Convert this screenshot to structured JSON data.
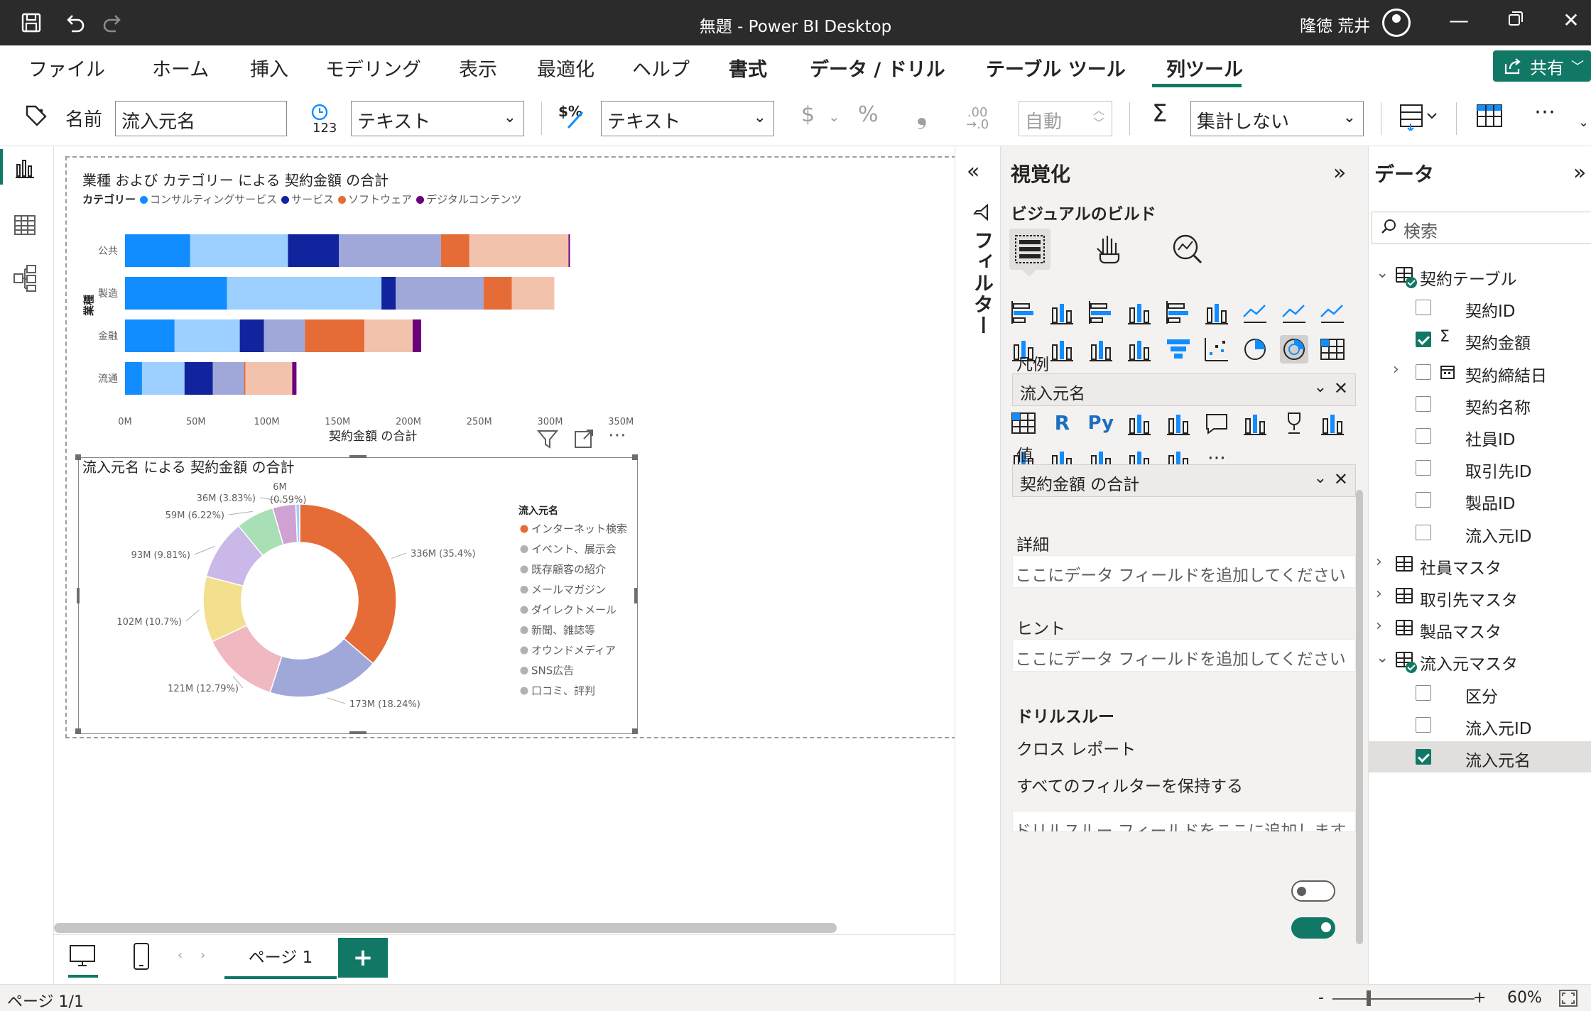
{
  "titlebar": {
    "title": "無題 - Power BI Desktop",
    "user": "隆徳 荒井",
    "icons": [
      "save-icon",
      "undo-icon",
      "redo-icon"
    ]
  },
  "ribbon": {
    "tabs": [
      "ファイル",
      "ホーム",
      "挿入",
      "モデリング",
      "表示",
      "最適化",
      "ヘルプ",
      "書式",
      "データ / ドリル",
      "テーブル ツール",
      "列ツール"
    ],
    "active_tab": "列ツール",
    "share_label": "共有"
  },
  "toolbar": {
    "name_label": "名前",
    "name_value": "流入元名",
    "datatype_value": "テキスト",
    "format_value": "テキスト",
    "currency_symbol": "$",
    "percent_symbol": "%",
    "comma_symbol": "❟",
    "decimal_symbol": ".00",
    "auto_value": "自動",
    "sigma_symbol": "Σ",
    "summarize_value": "集計しない",
    "more": "⋯"
  },
  "bar_chart": {
    "title": "業種 および カテゴリー による 契約金額 の合計",
    "legend_title": "カテゴリー",
    "x_axis_title": "契約金額 の合計",
    "y_axis_title": "業種"
  },
  "donut_chart": {
    "title": "流入元名 による 契約金額 の合計",
    "legend_title": "流入元名"
  },
  "chart_data": [
    {
      "type": "bar",
      "orientation": "horizontal-stacked",
      "title": "業種 および カテゴリー による 契約金額 の合計",
      "xlabel": "契約金額 の合計",
      "ylabel": "業種",
      "categories": [
        "公共",
        "製造",
        "金融",
        "流通"
      ],
      "x_ticks": [
        "0M",
        "50M",
        "100M",
        "150M",
        "200M",
        "250M",
        "300M",
        "350M"
      ],
      "xlim": [
        0,
        350
      ],
      "legend_title": "カテゴリー",
      "legend_placement": "top-left",
      "series": [
        {
          "name": "コンサルティングサービス",
          "color": "#118dff",
          "values": [
            46,
            72,
            35,
            12
          ],
          "light_values": [
            69,
            109,
            46,
            30
          ]
        },
        {
          "name": "サービス",
          "color": "#12239e",
          "values": [
            36,
            10,
            17,
            20
          ],
          "light_values": [
            72,
            62,
            29,
            22
          ]
        },
        {
          "name": "ソフトウェア",
          "color": "#e66c37",
          "values": [
            20,
            20,
            42,
            1
          ],
          "light_values": [
            70,
            30,
            34,
            33
          ]
        },
        {
          "name": "デジタルコンテンツ",
          "color": "#6b007b",
          "values": [
            1,
            0,
            6,
            3
          ],
          "light_values": [
            0,
            0,
            0,
            0
          ]
        }
      ],
      "light_colors": [
        "#9dcfff",
        "#a0a7d9",
        "#f3c2ad",
        "#c48ec9"
      ]
    },
    {
      "type": "pie",
      "style": "donut",
      "title": "流入元名 による 契約金額 の合計",
      "legend_title": "流入元名",
      "legend_placement": "right",
      "slices": [
        {
          "name": "インターネット検索",
          "value": 336,
          "label": "336M (35.4%)",
          "color": "#e66c37",
          "highlight": true
        },
        {
          "name": "イベント、展示会",
          "value": 173,
          "label": "173M (18.24%)",
          "color": "#a0a7d9",
          "highlight": false
        },
        {
          "name": "既存顧客の紹介",
          "value": 121,
          "label": "121M (12.79%)",
          "color": "#f0b8c0",
          "highlight": false
        },
        {
          "name": "メールマガジン",
          "value": 102,
          "label": "102M (10.7%)",
          "color": "#f2e08f",
          "highlight": false
        },
        {
          "name": "ダイレクトメール",
          "value": 93,
          "label": "93M (9.81%)",
          "color": "#c9b8e8",
          "highlight": false
        },
        {
          "name": "新聞、雑誌等",
          "value": 59,
          "label": "59M (6.22%)",
          "color": "#a8dfb5",
          "highlight": false
        },
        {
          "name": "オウンドメディア",
          "value": 36,
          "label": "36M (3.83%)",
          "color": "#cfa2d3",
          "highlight": false
        },
        {
          "name": "SNS広告",
          "value": 6,
          "label": "6M (0.59%)",
          "color": "#9dcfff",
          "highlight": false
        },
        {
          "name": "口コミ、評判",
          "value": 0,
          "label": "",
          "color": "#b3b0ad",
          "highlight": false
        }
      ],
      "label_6m_top": "6M",
      "label_036": "(0.59%)"
    }
  ],
  "pages": {
    "tab_label": "ページ 1",
    "add_label": "+"
  },
  "status": {
    "page_info": "ページ 1/1",
    "zoom": "60%",
    "minus": "-",
    "plus": "+"
  },
  "filters_pane": {
    "label": "フィルター"
  },
  "viz_pane": {
    "title": "視覚化",
    "build_label": "ビジュアルのビルド",
    "wells": {
      "legend_label": "凡例",
      "legend_value": "流入元名",
      "values_label": "値",
      "values_value": "契約金額 の合計",
      "details_label": "詳細",
      "details_placeholder": "ここにデータ フィールドを追加してください",
      "tooltips_label": "ヒント",
      "tooltips_placeholder": "ここにデータ フィールドを追加してください"
    },
    "drill": {
      "title": "ドリルスルー",
      "cross_report": "クロス レポート",
      "keep_filters": "すべてのフィルターを保持する",
      "add_placeholder": "ドリルスルー フィールドをここに追加します",
      "cross_report_on": false,
      "keep_filters_on": true
    }
  },
  "data_pane": {
    "title": "データ",
    "search_placeholder": "検索",
    "tree": [
      {
        "kind": "table",
        "label": "契約テーブル",
        "expanded": true,
        "badge": true
      },
      {
        "kind": "field",
        "label": "契約ID",
        "checked": false,
        "icon": ""
      },
      {
        "kind": "field",
        "label": "契約金額",
        "checked": true,
        "icon": "Σ"
      },
      {
        "kind": "field",
        "label": "契約締結日",
        "checked": false,
        "icon": "calendar",
        "expandable": true
      },
      {
        "kind": "field",
        "label": "契約名称",
        "checked": false,
        "icon": ""
      },
      {
        "kind": "field",
        "label": "社員ID",
        "checked": false,
        "icon": ""
      },
      {
        "kind": "field",
        "label": "取引先ID",
        "checked": false,
        "icon": ""
      },
      {
        "kind": "field",
        "label": "製品ID",
        "checked": false,
        "icon": ""
      },
      {
        "kind": "field",
        "label": "流入元ID",
        "checked": false,
        "icon": ""
      },
      {
        "kind": "table",
        "label": "社員マスタ",
        "expanded": false,
        "badge": false
      },
      {
        "kind": "table",
        "label": "取引先マスタ",
        "expanded": false,
        "badge": false
      },
      {
        "kind": "table",
        "label": "製品マスタ",
        "expanded": false,
        "badge": false
      },
      {
        "kind": "table",
        "label": "流入元マスタ",
        "expanded": true,
        "badge": true
      },
      {
        "kind": "field",
        "label": "区分",
        "checked": false,
        "icon": ""
      },
      {
        "kind": "field",
        "label": "流入元ID",
        "checked": false,
        "icon": ""
      },
      {
        "kind": "field",
        "label": "流入元名",
        "checked": true,
        "icon": "",
        "selected": true
      }
    ]
  }
}
